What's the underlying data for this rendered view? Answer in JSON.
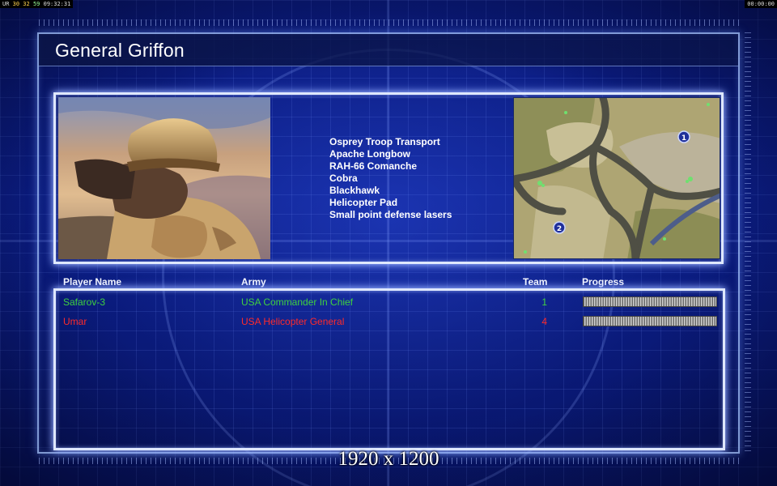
{
  "hud": {
    "left_prefix": "UR",
    "left_values": "30 32",
    "left_sub": "59",
    "clock": "09:32:31",
    "timer": "00:00:00"
  },
  "screen": {
    "title": "General Griffon",
    "units": [
      "Osprey Troop Transport",
      "Apache Longbow",
      "RAH-66 Comanche",
      "Cobra",
      "Blackhawk",
      "Helicopter Pad",
      "Small point defense lasers"
    ]
  },
  "minimap": {
    "markers": [
      "1",
      "2"
    ]
  },
  "table": {
    "headers": {
      "player": "Player Name",
      "army": "Army",
      "team": "Team",
      "progress": "Progress"
    },
    "rows": [
      {
        "player": "Safarov-3",
        "army": "USA Commander In Chief",
        "team": "1",
        "color": "#3fd13f",
        "progress": 1.0
      },
      {
        "player": "Umar",
        "army": "USA Helicopter General",
        "team": "4",
        "color": "#ff2a2a",
        "progress": 1.0
      }
    ]
  },
  "footer": {
    "resolution": "1920 x 1200"
  },
  "colors": {
    "background": "#0c1f8c",
    "panel_border": "#dfe8ff",
    "player_green": "#3fd13f",
    "player_red": "#ff2a2a"
  }
}
